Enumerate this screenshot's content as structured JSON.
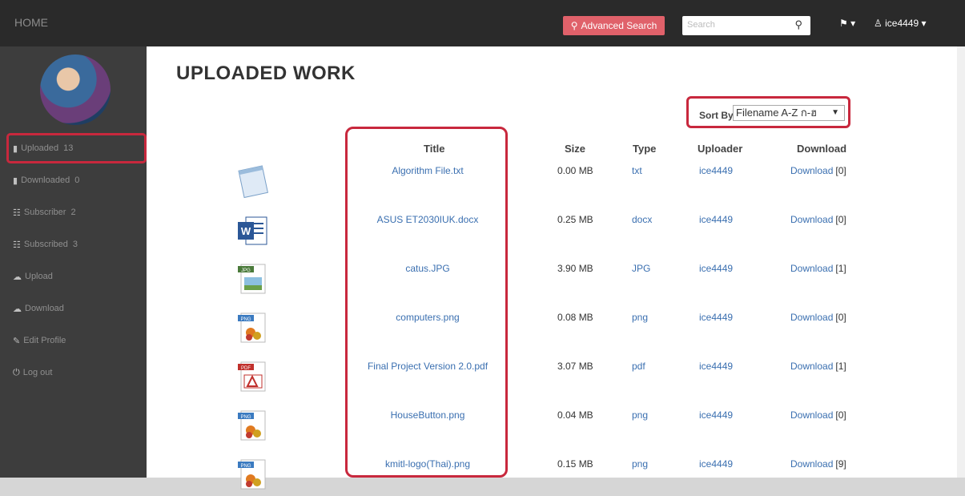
{
  "brand": "HOME",
  "header": {
    "advanced_search": "Advanced Search",
    "search_placeholder": "Search",
    "username": "ice4449"
  },
  "sidebar": {
    "items": [
      {
        "label": "Uploaded",
        "count": "13",
        "icon": "book-icon"
      },
      {
        "label": "Downloaded",
        "count": "0",
        "icon": "book-icon"
      },
      {
        "label": "Subscriber",
        "count": "2",
        "icon": "users-icon"
      },
      {
        "label": "Subscribed",
        "count": "3",
        "icon": "users-icon"
      },
      {
        "label": "Upload",
        "count": "",
        "icon": "cloud-upload-icon"
      },
      {
        "label": "Download",
        "count": "",
        "icon": "cloud-download-icon"
      },
      {
        "label": "Edit Profile",
        "count": "",
        "icon": "edit-icon"
      },
      {
        "label": "Log out",
        "count": "",
        "icon": "power-icon"
      }
    ]
  },
  "page": {
    "title": "UPLOADED WORK",
    "sort_label": "Sort By",
    "sort_value": "Filename A-Z ก-ฮ"
  },
  "table": {
    "headers": [
      "Title",
      "Size",
      "Type",
      "Uploader",
      "Download"
    ],
    "rows": [
      {
        "title": "Algorithm File.txt",
        "size": "0.00 MB",
        "type": "txt",
        "uploader": "ice4449",
        "download": "Download",
        "count": "[0]",
        "icon": "notepad-icon"
      },
      {
        "title": "ASUS ET2030IUK.docx",
        "size": "0.25 MB",
        "type": "docx",
        "uploader": "ice4449",
        "download": "Download",
        "count": "[0]",
        "icon": "word-icon"
      },
      {
        "title": "catus.JPG",
        "size": "3.90 MB",
        "type": "JPG",
        "uploader": "ice4449",
        "download": "Download",
        "count": "[1]",
        "icon": "jpg-icon"
      },
      {
        "title": "computers.png",
        "size": "0.08 MB",
        "type": "png",
        "uploader": "ice4449",
        "download": "Download",
        "count": "[0]",
        "icon": "png-icon"
      },
      {
        "title": "Final Project Version 2.0.pdf",
        "size": "3.07 MB",
        "type": "pdf",
        "uploader": "ice4449",
        "download": "Download",
        "count": "[1]",
        "icon": "pdf-icon"
      },
      {
        "title": "HouseButton.png",
        "size": "0.04 MB",
        "type": "png",
        "uploader": "ice4449",
        "download": "Download",
        "count": "[0]",
        "icon": "png-icon"
      },
      {
        "title": "kmitl-logo(Thai).png",
        "size": "0.15 MB",
        "type": "png",
        "uploader": "ice4449",
        "download": "Download",
        "count": "[9]",
        "icon": "png-icon"
      }
    ]
  },
  "colors": {
    "accent": "#c8283d",
    "link": "#3a6fb0",
    "nav_bg": "#3d3d3d",
    "topbar_bg": "#2a2a2a",
    "button": "#e0616a"
  }
}
